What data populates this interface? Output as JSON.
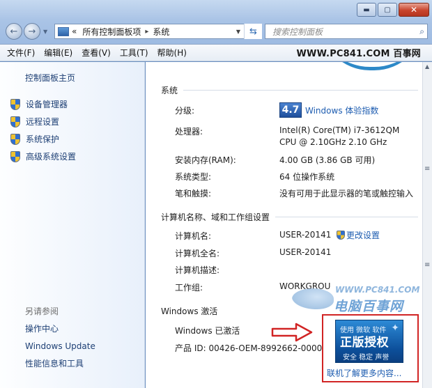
{
  "window": {
    "minimize": "▬",
    "maximize": "▢",
    "close": "✕"
  },
  "nav": {
    "back": "←",
    "forward": "→"
  },
  "address": {
    "prefix": "«",
    "crumb1": "所有控制面板项",
    "separator": "▸",
    "crumb2": "系统"
  },
  "search": {
    "placeholder": "搜索控制面板"
  },
  "menu": {
    "items": [
      "文件(F)",
      "编辑(E)",
      "查看(V)",
      "工具(T)",
      "帮助(H)"
    ]
  },
  "brand": "WWW.PC841.COM 百事网",
  "sidebar": {
    "home": "控制面板主页",
    "links": [
      "设备管理器",
      "远程设置",
      "系统保护",
      "高级系统设置"
    ],
    "see_also": "另请参阅",
    "bottom_links": [
      "操作中心",
      "Windows Update",
      "性能信息和工具"
    ]
  },
  "system": {
    "heading": "系统",
    "rating_label": "分级:",
    "rating_value": "4.7",
    "rating_link": "Windows 体验指数",
    "processor_label": "处理器:",
    "processor_value_1": "Intel(R) Core(TM) i7-3612QM",
    "processor_value_2": "CPU @ 2.10GHz   2.10 GHz",
    "ram_label": "安装内存(RAM):",
    "ram_value": "4.00 GB (3.86 GB 可用)",
    "type_label": "系统类型:",
    "type_value": "64 位操作系统",
    "pen_label": "笔和触摸:",
    "pen_value": "没有可用于此显示器的笔或触控输入"
  },
  "computer": {
    "heading": "计算机名称、域和工作组设置",
    "name_label": "计算机名:",
    "name_value": "USER-20141",
    "change_link": "更改设置",
    "fullname_label": "计算机全名:",
    "fullname_value": "USER-20141",
    "desc_label": "计算机描述:",
    "workgroup_label": "工作组:",
    "workgroup_value": "WORKGROU"
  },
  "activation": {
    "heading": "Windows 激活",
    "status": "Windows 已激活",
    "product_id": "产品 ID: 00426-OEM-8992662-00006"
  },
  "genuine": {
    "line1": "使用 微软 软件",
    "line2": "正版授权",
    "line3": "安全 稳定 声誉",
    "link": "联机了解更多内容..."
  },
  "watermark": {
    "url": "WWW.PC841.COM",
    "text": "电脑百事网"
  },
  "colors": {
    "link": "#1d5cb0",
    "highlight_border": "#d12424",
    "badge_blue": "#0c4f9a"
  }
}
